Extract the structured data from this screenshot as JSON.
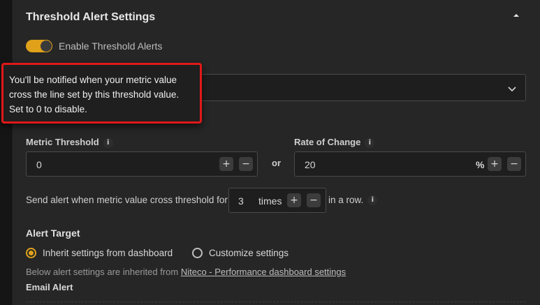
{
  "header": {
    "title": "Threshold Alert Settings"
  },
  "toggle": {
    "label": "Enable Threshold Alerts",
    "enabled": true
  },
  "tooltip": {
    "lines": [
      "You'll be notified when your metric value",
      "cross the line set by this threshold value.",
      "Set to 0 to disable."
    ]
  },
  "metric_threshold": {
    "label": "Metric Threshold",
    "value": "0",
    "plus": "+",
    "minus": "−"
  },
  "or_label": "or",
  "rate_of_change": {
    "label": "Rate of Change",
    "value": "20",
    "unit": "%",
    "plus": "+",
    "minus": "−"
  },
  "alert_rule": {
    "prefix": "Send alert when metric value cross threshold for",
    "value": "3",
    "unit": "times",
    "plus": "+",
    "minus": "−",
    "suffix": "in a row."
  },
  "alert_target": {
    "title": "Alert Target",
    "options": [
      {
        "label": "Inherit settings from dashboard",
        "selected": true
      },
      {
        "label": "Customize settings",
        "selected": false
      }
    ],
    "note_prefix": "Below alert settings are inherited from",
    "note_link": "Niteco - Performance dashboard settings"
  },
  "email_alert": {
    "title": "Email Alert"
  },
  "info_glyph": "i",
  "colors": {
    "accent": "#e0a21a",
    "tooltip_border": "#e01818",
    "panel_bg": "#262626",
    "page_bg": "#151515"
  },
  "icons": {
    "collapse": "chevron-up-icon",
    "select": "chevron-down-icon",
    "info": "info-icon"
  }
}
